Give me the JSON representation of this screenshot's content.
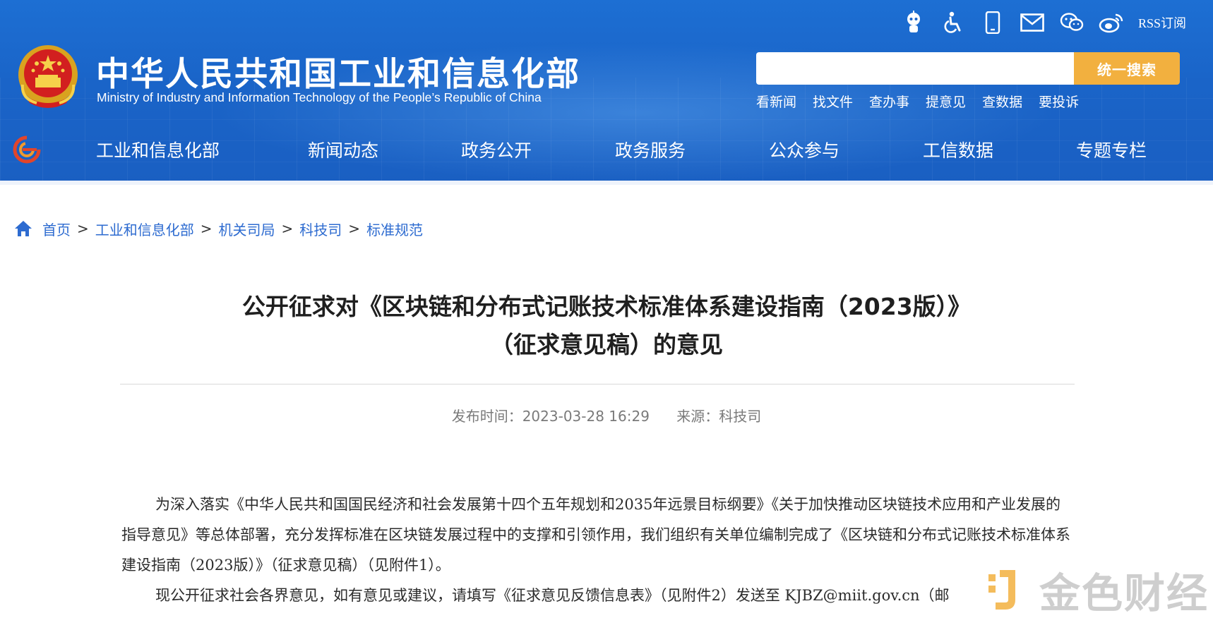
{
  "header": {
    "title_cn": "中华人民共和国工业和信息化部",
    "title_en": "Ministry of Industry and Information Technology of the People’s Republic of China",
    "rss_label": "RSS订阅",
    "search": {
      "placeholder": "",
      "button_label": "统一搜索"
    },
    "quick_links": [
      "看新闻",
      "找文件",
      "查办事",
      "提意见",
      "查数据",
      "要投诉"
    ]
  },
  "nav": {
    "items": [
      "工业和信息化部",
      "新闻动态",
      "政务公开",
      "政务服务",
      "公众参与",
      "工信数据",
      "专题专栏"
    ]
  },
  "breadcrumb": [
    "首页",
    "工业和信息化部",
    "机关司局",
    "科技司",
    "标准规范"
  ],
  "article": {
    "title_line1": "公开征求对《区块链和分布式记账技术标准体系建设指南（2023版）》",
    "title_line2": "（征求意见稿）的意见",
    "publish_time": "发布时间：2023-03-28 16:29",
    "source": "来源：科技司",
    "paragraph1": "为深入落实《中华人民共和国国民经济和社会发展第十四个五年规划和2035年远景目标纲要》《关于加快推动区块链技术应用和产业发展的指导意见》等总体部署，充分发挥标准在区块链发展过程中的支撑和引领作用，我们组织有关单位编制完成了《区块链和分布式记账技术标准体系建设指南（2023版）》（征求意见稿）（见附件1）。",
    "paragraph2": "现公开征求社会各界意见，如有意见或建议，请填写《征求意见反馈信息表》（见附件2）发送至 KJBZ@miit.gov.cn（邮"
  },
  "watermark": {
    "text": "金色财经"
  },
  "colors": {
    "header_blue": "#1a64c8",
    "search_button": "#f2b03f",
    "link_blue": "#2d6bd0"
  }
}
